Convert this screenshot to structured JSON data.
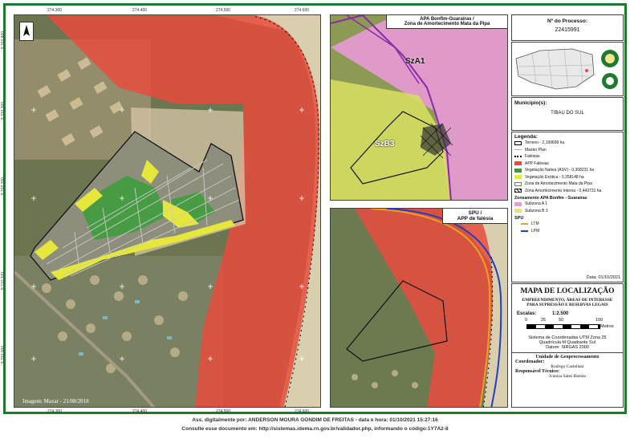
{
  "main_map": {
    "x_ticks": [
      "274.300",
      "274.400",
      "274.500",
      "274.600"
    ],
    "y_ticks": [
      "9.310.400",
      "9.310.300",
      "9.310.200",
      "9.310.100",
      "9.310.000"
    ],
    "imagery_credit": "Imagem: Maxar - 21/08/2018"
  },
  "inset_apa": {
    "title_line1": "APA Bonfim-Guaraíras /",
    "title_line2": "Zona de Amortecimento Mata da Pipa",
    "label_sza1": "SzA1",
    "label_szb3": "SzB3"
  },
  "inset_spu": {
    "title_line1": "SPU /",
    "title_line2": "APP de falésia"
  },
  "sidebar": {
    "process_label": "Nº do Processo:",
    "process_number": "22415991",
    "municipality_label": "Município(s):",
    "municipality": "TIBAU DO SUL",
    "legend_title": "Legenda:",
    "legend_items": [
      {
        "label": "Terreno - 2,199699 ha",
        "color": "#000000",
        "style": "outline"
      },
      {
        "label": "Master Plan",
        "color": "#b0b0b0",
        "style": "line"
      },
      {
        "label": "Falésias",
        "color": "#000000",
        "style": "dots"
      },
      {
        "label": "APP Falésias",
        "color": "#e84c3d",
        "style": "fill"
      },
      {
        "label": "Vegetação Nativa (ASV) - 0,308231 ha",
        "color": "#3a9d3a",
        "style": "fill"
      },
      {
        "label": "Vegetação Exótica - 0,358148 ha",
        "color": "#e5e83a",
        "style": "fill"
      },
      {
        "label": "Zona de Amortecimento Mata da Pipa",
        "color": "#b24fc6",
        "style": "outline"
      },
      {
        "label": "Zona Amortecimento Interna - 0,443731 ha",
        "color": "#222222",
        "style": "hatch"
      }
    ],
    "zoning_title": "Zoneamento APA Bonfim - Guaraíras",
    "zoning_items": [
      {
        "label": "Subzona A 1",
        "color": "#e89ad6"
      },
      {
        "label": "Subzona B 3",
        "color": "#e0e870"
      }
    ],
    "spu_title": "SPU",
    "spu_items": [
      {
        "label": "LTM",
        "color": "#f0a020"
      },
      {
        "label": "LPM",
        "color": "#2040c0"
      }
    ],
    "date": "Data: 01/10/2021",
    "map_title": "MAPA DE LOCALIZAÇÃO",
    "subtitle": "EMPREENDIMENTO, ÁREAS DE INTERESSE PARA SUPRESSÃO E RESERVAS LEGAIS",
    "scale_label": "Escalas:",
    "scale_value": "1:2.500",
    "scale_ticks": [
      "0",
      "25",
      "50",
      "100"
    ],
    "scale_unit": "Metros",
    "crs_line1": "Sistema de Coordenadas UTM Zona 25",
    "crs_line2": "Quadrícula M  Quadrante Sul",
    "crs_line3": "Datum: SIRGAS 2000",
    "unit_title": "Unidade de Geoprocessamento",
    "coord_label": "Coordenador:",
    "coord_name": "Rodrigo Castellani",
    "tech_label": "Responsável Técnico:",
    "tech_name": "Ivaniza Sales Batista"
  },
  "footer": {
    "line1": "Ass. digitalmente por: ANDERSON MOURA GONDIM DE FREITAS - data e hora: 01/10/2021 15:27:16",
    "line2": "Consulte esse documento em: http://sistemas.idema.rn.gov.br/validador.php, informando o código:1Y7A2-8"
  }
}
